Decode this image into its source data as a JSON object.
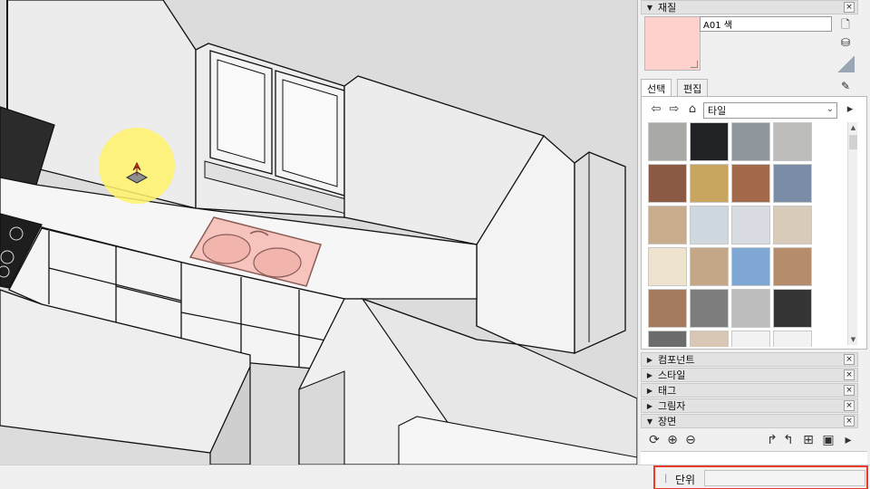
{
  "viewport": {
    "cursor_icon": "pushpull-icon"
  },
  "tray": {
    "materials": {
      "title": "재질",
      "name_value": "A01 색",
      "swatch_color": "#ffd1cc",
      "tabs": [
        {
          "label": "선택"
        },
        {
          "label": "편집"
        }
      ],
      "collection_selected": "타일",
      "tile_colors": [
        "#a9a9a6",
        "#202225",
        "#8f969c",
        "#bdbdbb",
        "#8a5a45",
        "#c8a65f",
        "#a26a4b",
        "#7a8ca6",
        "#c7ad8d",
        "#cfd7df",
        "#d8dbe1",
        "#d9cbb9",
        "#eee3cf",
        "#c4a788",
        "#7ea7d6",
        "#b68d6c",
        "#a57a5e",
        "#7d7d7d",
        "#bdbdbd",
        "#353535",
        "#6c6c6c",
        "#d8c7b5",
        "#f2f2f2",
        "#f2f2f2"
      ]
    },
    "panels": [
      {
        "label": "컴포넌트",
        "collapsed": true
      },
      {
        "label": "스타일",
        "collapsed": true
      },
      {
        "label": "태그",
        "collapsed": true
      },
      {
        "label": "그림자",
        "collapsed": true
      },
      {
        "label": "장면",
        "collapsed": false
      }
    ]
  },
  "status": {
    "measure_label": "단위",
    "measure_value": ""
  },
  "colors": {
    "highlight": "#e53c2e",
    "sink": "#f7c3bd",
    "cursor_glow": "#fff36a"
  }
}
